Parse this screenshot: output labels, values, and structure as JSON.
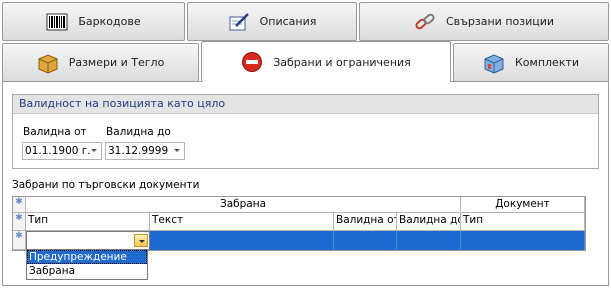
{
  "tabs_top": [
    {
      "label": "Баркодове",
      "icon": "barcode-icon"
    },
    {
      "label": "Описания",
      "icon": "notepad-pen-icon"
    },
    {
      "label": "Свързани позиции",
      "icon": "chain-link-icon"
    }
  ],
  "tabs_bottom": [
    {
      "label": "Размери и Тегло",
      "icon": "box-icon"
    },
    {
      "label": "Забрани и ограничения",
      "icon": "no-entry-icon",
      "active": true
    },
    {
      "label": "Комплекти",
      "icon": "cube-set-icon"
    }
  ],
  "validity": {
    "title": "Валидност на позицията като цяло",
    "from_label": "Валидна от",
    "from_value": "01.1.1900 г.",
    "to_label": "Валидна до",
    "to_value": "31.12.9999"
  },
  "grid": {
    "title": "Забрани по търговски документи",
    "bands": {
      "restriction": "Забрана",
      "document": "Документ"
    },
    "columns": [
      "Тип",
      "Текст",
      "Валидна от",
      "Валидна до",
      "Тип"
    ],
    "row_indicator": "✱"
  },
  "dropdown": {
    "options": [
      "Предупреждение",
      "Забрана"
    ],
    "highlighted": 0
  },
  "colors": {
    "accent": "#1f6acf",
    "group_title": "#1f3b80",
    "no_entry_red": "#d62a1f"
  }
}
